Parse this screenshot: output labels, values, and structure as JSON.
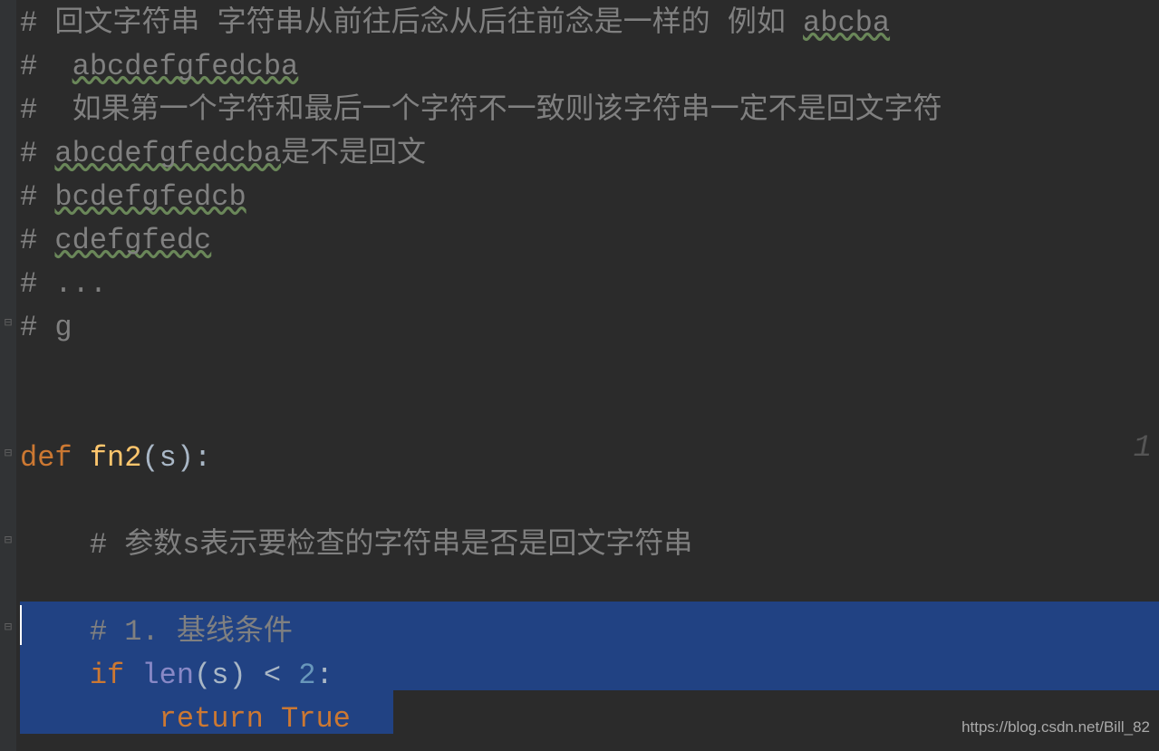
{
  "lines": {
    "l1_prefix": "# ",
    "l1_a": "回文字符串",
    "l1_b": " 字符串从前往后念从后往前念是一样的 例如 ",
    "l1_c": "abcba",
    "l2_prefix": "#  ",
    "l2_a": "abcdefgfedcba",
    "l3": "#  如果第一个字符和最后一个字符不一致则该字符串一定不是回文字符",
    "l4_prefix": "# ",
    "l4_a": "abcdefgfedcba",
    "l4_b": "是不是回文",
    "l5_prefix": "# ",
    "l5_a": "bcdefgfedcb",
    "l6_prefix": "# ",
    "l6_a": "cdefgfedc",
    "l7": "# ...",
    "l8": "# g",
    "def_kw": "def ",
    "fn_name": "fn2",
    "def_paren_open": "(",
    "def_param": "s",
    "def_paren_close": ")",
    "def_colon": ":",
    "l_inner_comment": "    # 参数s表示要检查的字符串是否是回文字符串",
    "l_base_comment": "    # 1. 基线条件",
    "if_indent": "    ",
    "if_kw": "if ",
    "len_fn": "len",
    "if_open": "(",
    "if_var": "s",
    "if_close": ") ",
    "lt": "< ",
    "num2": "2",
    "if_colon": ":",
    "ret_indent": "        ",
    "ret_kw": "return ",
    "true_kw": "True"
  },
  "usage_hint": "1",
  "watermark": "https://blog.csdn.net/Bill_82"
}
